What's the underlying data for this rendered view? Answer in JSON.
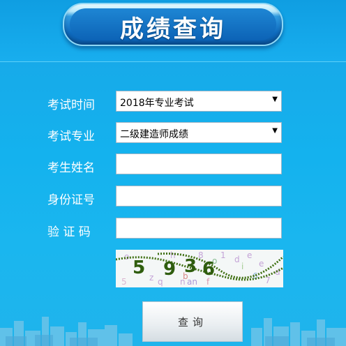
{
  "header": {
    "title": "成绩查询"
  },
  "form": {
    "exam_time": {
      "label": "考试时间",
      "value": "2018年专业考试"
    },
    "exam_major": {
      "label": "考试专业",
      "value": "二级建造师成绩"
    },
    "name": {
      "label": "考生姓名",
      "value": ""
    },
    "id_number": {
      "label": "身份证号",
      "value": ""
    },
    "captcha": {
      "label": "验 证 码",
      "value": "",
      "code": "5936"
    },
    "submit_label": "查询"
  },
  "colors": {
    "background": "#14b2ee",
    "title_bg": "#0c63b6",
    "label": "#ffffff"
  }
}
